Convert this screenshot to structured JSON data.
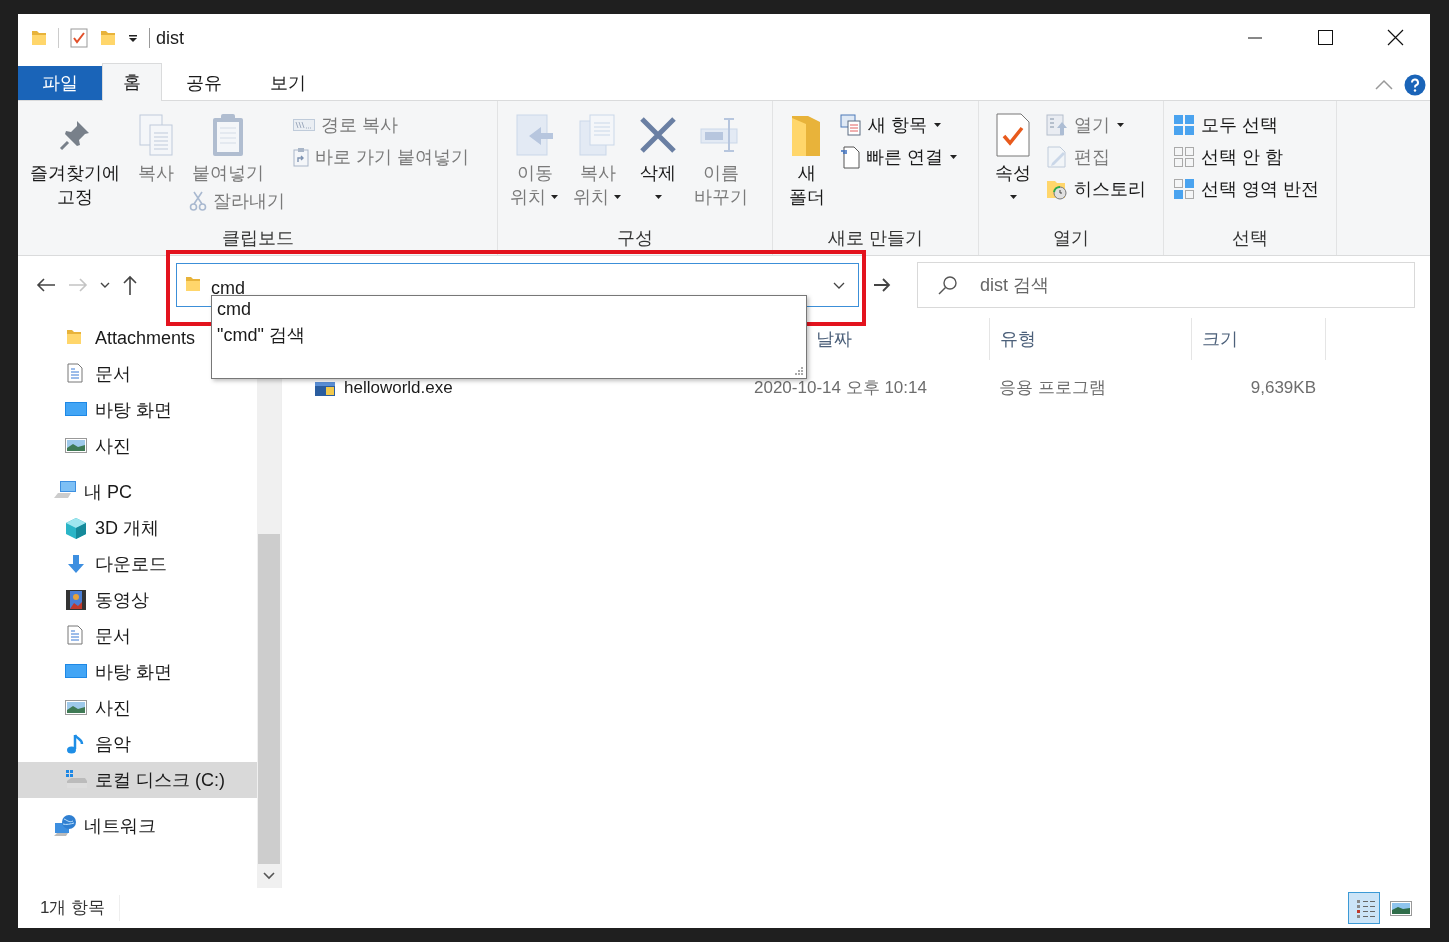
{
  "title_bar": {
    "title": "dist"
  },
  "ribbon_tabs": [
    {
      "label": "파일",
      "kind": "file",
      "selected": false
    },
    {
      "label": "홈",
      "kind": "tab",
      "selected": true
    },
    {
      "label": "공유",
      "kind": "tab",
      "selected": false
    },
    {
      "label": "보기",
      "kind": "tab",
      "selected": false
    }
  ],
  "ribbon_groups": [
    {
      "label": "클립보드",
      "columns": [
        [
          {
            "label": "즐겨찾기에\n고정",
            "kind": "large",
            "dropdown": false,
            "disabled": false
          }
        ],
        [
          {
            "label": "복사",
            "kind": "large",
            "dropdown": false,
            "disabled": true
          }
        ],
        [
          {
            "label": "붙여넣기",
            "kind": "large",
            "dropdown": false,
            "disabled": true
          },
          {
            "label": "잘라내기",
            "kind": "small",
            "dropdown": false,
            "disabled": true
          }
        ],
        [
          {
            "label": "경로 복사",
            "kind": "small",
            "dropdown": false,
            "disabled": true
          },
          {
            "label": "바로 가기 붙여넣기",
            "kind": "small",
            "dropdown": false,
            "disabled": true
          }
        ]
      ]
    },
    {
      "label": "구성",
      "columns": [
        [
          {
            "label": "이동\n위치",
            "kind": "large",
            "dropdown": true,
            "disabled": true
          }
        ],
        [
          {
            "label": "복사\n위치",
            "kind": "large",
            "dropdown": true,
            "disabled": true
          }
        ],
        [
          {
            "label": "삭제",
            "kind": "large",
            "dropdown": true,
            "disabled": false
          }
        ],
        [
          {
            "label": "이름\n바꾸기",
            "kind": "large",
            "dropdown": false,
            "disabled": true
          }
        ]
      ]
    },
    {
      "label": "새로 만들기",
      "columns": [
        [
          {
            "label": "새\n폴더",
            "kind": "large",
            "dropdown": false,
            "disabled": false
          }
        ],
        [
          {
            "label": "새 항목",
            "kind": "small",
            "dropdown": true,
            "disabled": false
          },
          {
            "label": "빠른 연결",
            "kind": "small",
            "dropdown": true,
            "disabled": false
          }
        ]
      ]
    },
    {
      "label": "열기",
      "columns": [
        [
          {
            "label": "속성",
            "kind": "large",
            "dropdown": true,
            "disabled": false
          }
        ],
        [
          {
            "label": "열기",
            "kind": "small",
            "dropdown": true,
            "disabled": true
          },
          {
            "label": "편집",
            "kind": "small",
            "dropdown": false,
            "disabled": true
          },
          {
            "label": "히스토리",
            "kind": "small",
            "dropdown": false,
            "disabled": false
          }
        ]
      ]
    },
    {
      "label": "선택",
      "columns": [
        [
          {
            "label": "모두 선택",
            "kind": "small",
            "dropdown": false,
            "disabled": false
          },
          {
            "label": "선택 안 함",
            "kind": "small",
            "dropdown": false,
            "disabled": false
          },
          {
            "label": "선택 영역 반전",
            "kind": "small",
            "dropdown": false,
            "disabled": false
          }
        ]
      ]
    }
  ],
  "address_bar": {
    "value": "cmd",
    "suggestions": [
      {
        "label": "cmd"
      },
      {
        "label": "\"cmd\" 검색"
      }
    ]
  },
  "search": {
    "placeholder": "dist 검색"
  },
  "sidebar": [
    {
      "items": [
        {
          "label": "Attachments",
          "selected": false
        },
        {
          "label": "문서",
          "selected": false
        },
        {
          "label": "바탕 화면",
          "selected": false
        },
        {
          "label": "사진",
          "selected": false
        }
      ]
    },
    {
      "label": "내 PC",
      "children": [
        {
          "label": "3D 개체",
          "selected": false
        },
        {
          "label": "다운로드",
          "selected": false
        },
        {
          "label": "동영상",
          "selected": false
        },
        {
          "label": "문서",
          "selected": false
        },
        {
          "label": "바탕 화면",
          "selected": false
        },
        {
          "label": "사진",
          "selected": false
        },
        {
          "label": "음악",
          "selected": false
        },
        {
          "label": "로컬 디스크 (C:)",
          "selected": true
        }
      ]
    },
    {
      "label": "네트워크"
    }
  ],
  "file_list": {
    "columns": [
      {
        "label": "날짜"
      },
      {
        "label": "유형"
      },
      {
        "label": "크기"
      }
    ],
    "rows": [
      {
        "name": "helloworld.exe",
        "date": "2020-10-14 오후 10:14",
        "type": "응용 프로그램",
        "size": "9,639KB"
      }
    ]
  },
  "status_bar": {
    "text": "1개 항목",
    "views": [
      {
        "selected": true
      },
      {
        "selected": false
      }
    ]
  }
}
